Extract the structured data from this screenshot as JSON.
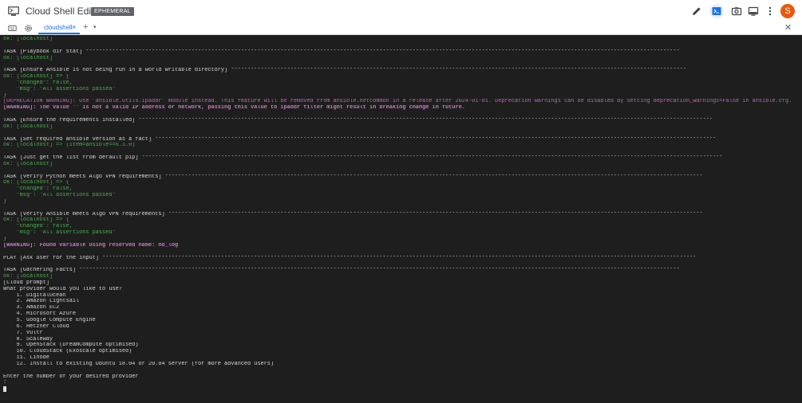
{
  "app": {
    "title": "Cloud Shell Editor",
    "badge": "EPHEMERAL",
    "avatar_letter": "S",
    "accent_color": "#1a73e8",
    "avatar_color": "#e8590c",
    "icons": [
      "cloud-shell-logo-icon",
      "pencil-icon",
      "terminal-icon",
      "camera-icon",
      "monitor-icon",
      "more-vert-icon"
    ]
  },
  "tabs": {
    "active_label": "cloudshell",
    "close_glyph": "×",
    "add_glyph": "+",
    "caret_glyph": "▾",
    "panel_close_glyph": "✕",
    "icons": [
      "keyboard-icon",
      "settings-icon"
    ]
  },
  "terminal": {
    "lines": [
      {
        "text": "ok: [localhost]",
        "color": "green"
      },
      {
        "text": "",
        "color": "white"
      },
      {
        "text": "TASK [Playbook dir stat] ************************************************************************************************************************************************************************************",
        "color": "white"
      },
      {
        "text": "ok: [localhost]",
        "color": "green"
      },
      {
        "text": "",
        "color": "white"
      },
      {
        "text": "TASK [Ensure Ansible is not being run in a world writable directory] ******************************************************************************************************************************************",
        "color": "white"
      },
      {
        "text": "ok: [localhost] => {",
        "color": "green"
      },
      {
        "text": "    \"changed\": false,",
        "color": "green"
      },
      {
        "text": "    \"msg\": \"All assertions passed\"",
        "color": "green"
      },
      {
        "text": "}",
        "color": "green"
      },
      {
        "text": "[DEPRECATION WARNING]: Use 'ansible.utils.ipaddr' module instead. This feature will be removed from ansible.netcommon in a release after 2024-01-01. Deprecation warnings can be disabled by setting deprecation_warnings=False in ansible.cfg.",
        "color": "purple"
      },
      {
        "text": "[WARNING]: The value '' is not a valid IP address or network, passing this value to ipaddr filter might result in breaking change in future.",
        "color": "purple-b"
      },
      {
        "text": "",
        "color": "white"
      },
      {
        "text": "TASK [Ensure the requirements installed] ******************************************************************************************************************************************************************************",
        "color": "white"
      },
      {
        "text": "ok: [localhost]",
        "color": "green"
      },
      {
        "text": "",
        "color": "white"
      },
      {
        "text": "TASK [Set required ansible version as a fact] **************************************************************************************************************************************************************************",
        "color": "white"
      },
      {
        "text": "ok: [localhost] => (item=ansible==6.1.0)",
        "color": "green"
      },
      {
        "text": "",
        "color": "white"
      },
      {
        "text": "TASK [Just get the list from default pip] ********************************************************************************************************************************************************************************",
        "color": "white"
      },
      {
        "text": "ok: [localhost]",
        "color": "green"
      },
      {
        "text": "",
        "color": "white"
      },
      {
        "text": "TASK [Verify Python meets Algo VPN requirements] *******************************************************************************************************************************************************************",
        "color": "white"
      },
      {
        "text": "ok: [localhost] => {",
        "color": "green"
      },
      {
        "text": "    \"changed\": false,",
        "color": "green"
      },
      {
        "text": "    \"msg\": \"All assertions passed\"",
        "color": "green"
      },
      {
        "text": "}",
        "color": "green"
      },
      {
        "text": "",
        "color": "white"
      },
      {
        "text": "TASK [Verify Ansible meets Algo VPN requirements] ******************************************************************************************************************************************************************",
        "color": "white"
      },
      {
        "text": "ok: [localhost] => {",
        "color": "green"
      },
      {
        "text": "    \"changed\": false,",
        "color": "green"
      },
      {
        "text": "    \"msg\": \"All assertions passed\"",
        "color": "green"
      },
      {
        "text": "}",
        "color": "green"
      },
      {
        "text": "[WARNING]: Found variable using reserved name: no_log",
        "color": "purple-b"
      },
      {
        "text": "",
        "color": "white"
      },
      {
        "text": "PLAY [Ask user for the input] ************************************************************************************************************************************************************************************",
        "color": "white"
      },
      {
        "text": "",
        "color": "white"
      },
      {
        "text": "TASK [Gathering Facts] **************************************************************************************************************************************************************************************",
        "color": "white"
      },
      {
        "text": "ok: [localhost]",
        "color": "green"
      },
      {
        "text": "[Cloud prompt]",
        "color": "white"
      },
      {
        "text": "What provider would you like to use?",
        "color": "white"
      },
      {
        "text": "    1. DigitalOcean",
        "color": "white"
      },
      {
        "text": "    2. Amazon Lightsail",
        "color": "white"
      },
      {
        "text": "    3. Amazon EC2",
        "color": "white"
      },
      {
        "text": "    4. Microsoft Azure",
        "color": "white"
      },
      {
        "text": "    5. Google Compute Engine",
        "color": "white"
      },
      {
        "text": "    6. Hetzner Cloud",
        "color": "white"
      },
      {
        "text": "    7. Vultr",
        "color": "white"
      },
      {
        "text": "    8. Scaleway",
        "color": "white"
      },
      {
        "text": "    9. OpenStack (DreamCompute optimised)",
        "color": "white"
      },
      {
        "text": "    10. CloudStack (Exoscale optimised)",
        "color": "white"
      },
      {
        "text": "    11. Linode",
        "color": "white"
      },
      {
        "text": "    12. Install to existing Ubuntu 18.04 or 20.04 server (for more advanced users)",
        "color": "white"
      },
      {
        "text": "",
        "color": "white"
      },
      {
        "text": "Enter the number of your desired provider",
        "color": "white"
      },
      {
        "text": ":",
        "color": "white"
      }
    ]
  }
}
